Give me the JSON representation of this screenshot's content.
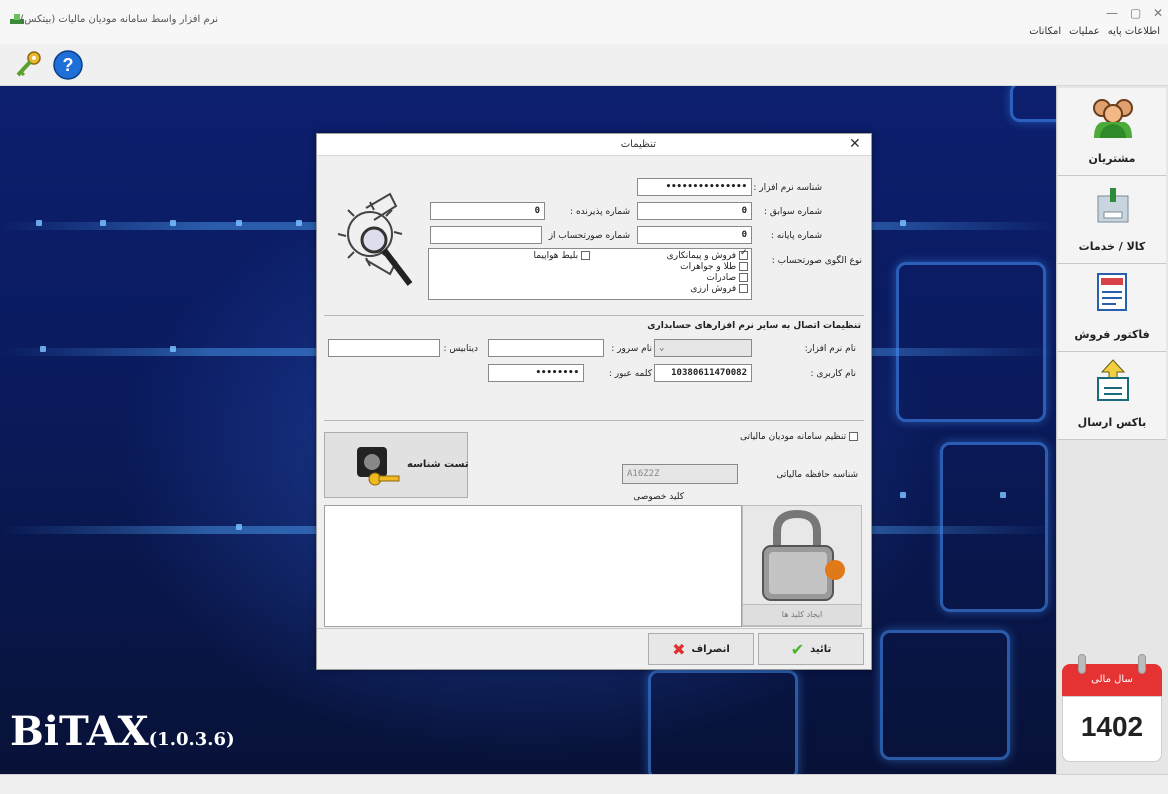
{
  "window": {
    "title": "نرم افزار واسط سامانه مودیان مالیات (بیتکس)",
    "minimize": "—",
    "maximize": "▢",
    "close": "✕"
  },
  "menu": [
    "اطلاعات پایه",
    "عملیات",
    "امکانات"
  ],
  "toolbar": {
    "key_icon": "key-icon",
    "help_icon": "help-icon"
  },
  "brand": {
    "name": "BiTAX",
    "version": "(1.0.3.6)"
  },
  "sidebar": {
    "items": [
      {
        "label": "مشتریان",
        "icon": "customers-icon"
      },
      {
        "label": "کالا / خدمات",
        "icon": "goods-services-icon"
      },
      {
        "label": "فاکتور فروش",
        "icon": "invoice-icon"
      },
      {
        "label": "باکس ارسال",
        "icon": "send-box-icon"
      }
    ],
    "fiscal_year_label": "سال مالی",
    "fiscal_year": "1402"
  },
  "dialog": {
    "title": "تنظیمات",
    "close": "✕",
    "software_id_label": "شناسه نرم افزار :",
    "software_id_value": "•••••••••••••••",
    "serial_label": "شماره سوابق :",
    "serial_value": "0",
    "acceptance_label": "شماره پذیرنده :",
    "acceptance_value": "0",
    "terminal_label": "شماره پایانه :",
    "terminal_value": "0",
    "invoice_from_label": "شماره صورتحساب از",
    "invoice_from_value": "",
    "pattern_label": "نوع الگوی صورتحساب :",
    "patterns": [
      {
        "label": "فروش و پیمانکاری",
        "checked": true
      },
      {
        "label": "طلا و جواهرات",
        "checked": false
      },
      {
        "label": "صادرات",
        "checked": false
      },
      {
        "label": "فروش ارزی",
        "checked": false
      }
    ],
    "airline_ticket": {
      "label": "بلیط هواپیما",
      "checked": false
    },
    "connection_section_title": "تنظیمات اتصال به سایر نرم افزارهای حسابداری",
    "software_name_label": "نام نرم افزار:",
    "server_label": "نام سرور :",
    "server_value": "",
    "database_label": "دیتابیس :",
    "database_value": "",
    "username_label": "نام کاربری :",
    "username_value": "10380611470082",
    "password_label": "کلمه عبور :",
    "password_value": "••••••••",
    "tax_system_setup": {
      "label": "تنظیم سامانه مودیان مالیاتی",
      "checked": false
    },
    "test_id_button": "تست شناسه",
    "memory_id_label": "شناسه حافظه مالیاتی",
    "memory_id_value": "A16Z2Z",
    "private_key_label": "کلید خصوصی",
    "private_key_value": "",
    "generate_keys_button": "ایجاد کلید ها",
    "confirm_button": "تائید",
    "cancel_button": "انصراف"
  }
}
